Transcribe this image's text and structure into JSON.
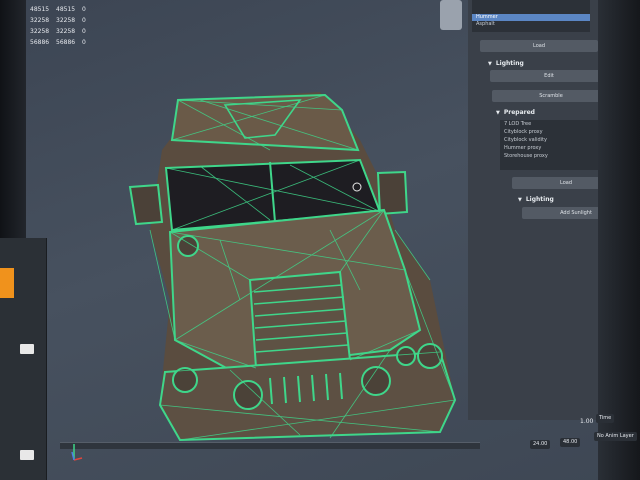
{
  "stats": {
    "rows": [
      [
        "48515",
        "48515",
        "0"
      ],
      [
        "32258",
        "32258",
        "0"
      ],
      [
        "32258",
        "32258",
        "0"
      ],
      [
        "56886",
        "56886",
        "0"
      ]
    ]
  },
  "panel": {
    "selection_items": [
      "",
      "",
      "Hummer",
      "Asphalt"
    ],
    "load_button_top": "Load",
    "lighting_header": "Lighting",
    "edit_button": "Edit",
    "scramble_button": "Scramble",
    "prepare_header": "Prepared",
    "project_items": [
      "7 LOD Tree",
      "Cityblock proxy",
      "Cityblock validity",
      "Hummer proxy",
      "Storehouse proxy"
    ],
    "load_button_bottom": "Load",
    "lighting_header_2": "Lighting",
    "add_button": "Add Sunlight"
  },
  "timeline": {
    "frame_start": "24.00",
    "frame_end": "48.00",
    "current": "1.00",
    "mode": "Time",
    "label": "No Anim Layer"
  },
  "colors": {
    "wire": "#3fd68a",
    "accent_orange": "#f0921c",
    "selection_blue": "#5b86c4"
  }
}
